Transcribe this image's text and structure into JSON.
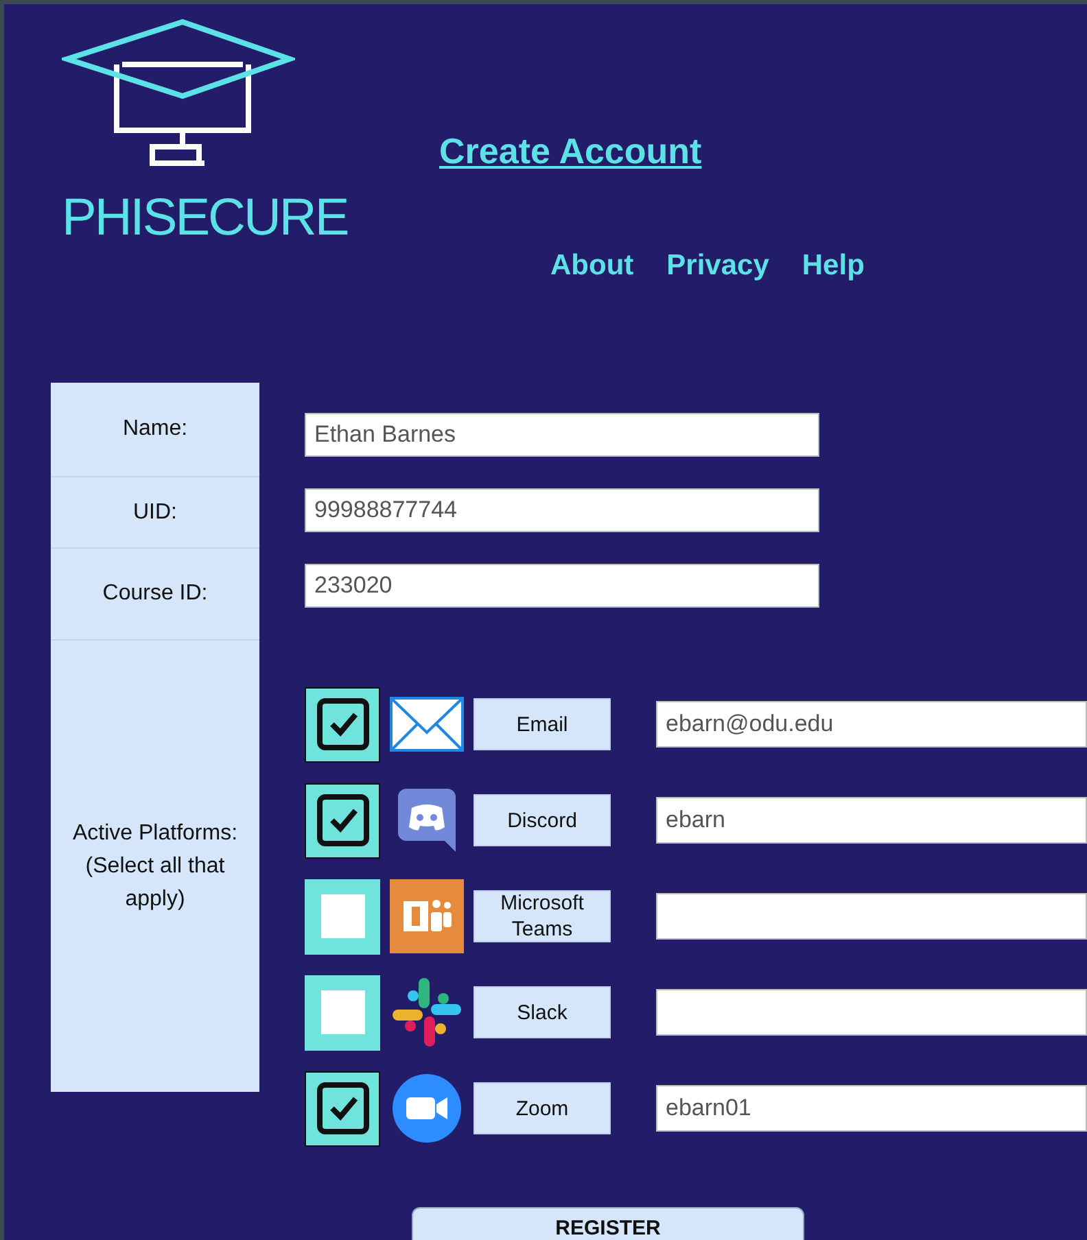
{
  "logo": {
    "text": "PHISECURE"
  },
  "header": {
    "title": "Create Account",
    "nav": [
      "About",
      "Privacy",
      "Help"
    ]
  },
  "form": {
    "fields": [
      {
        "label": "Name:",
        "value": "Ethan Barnes"
      },
      {
        "label": "UID:",
        "value": "99988877744"
      },
      {
        "label": "Course ID:",
        "value": "233020"
      }
    ],
    "platforms_label": "Active Platforms: (Select all that apply)",
    "platforms": [
      {
        "kind": "email",
        "label": "Email",
        "checked": true,
        "value": "ebarn@odu.edu"
      },
      {
        "kind": "discord",
        "label": "Discord",
        "checked": true,
        "value": "ebarn"
      },
      {
        "kind": "teams",
        "label": "Microsoft Teams",
        "checked": false
      },
      {
        "kind": "slack",
        "label": "Slack",
        "checked": false
      },
      {
        "kind": "zoom",
        "label": "Zoom",
        "checked": true,
        "value": "ebarn01"
      }
    ],
    "submit": "REGISTER"
  }
}
